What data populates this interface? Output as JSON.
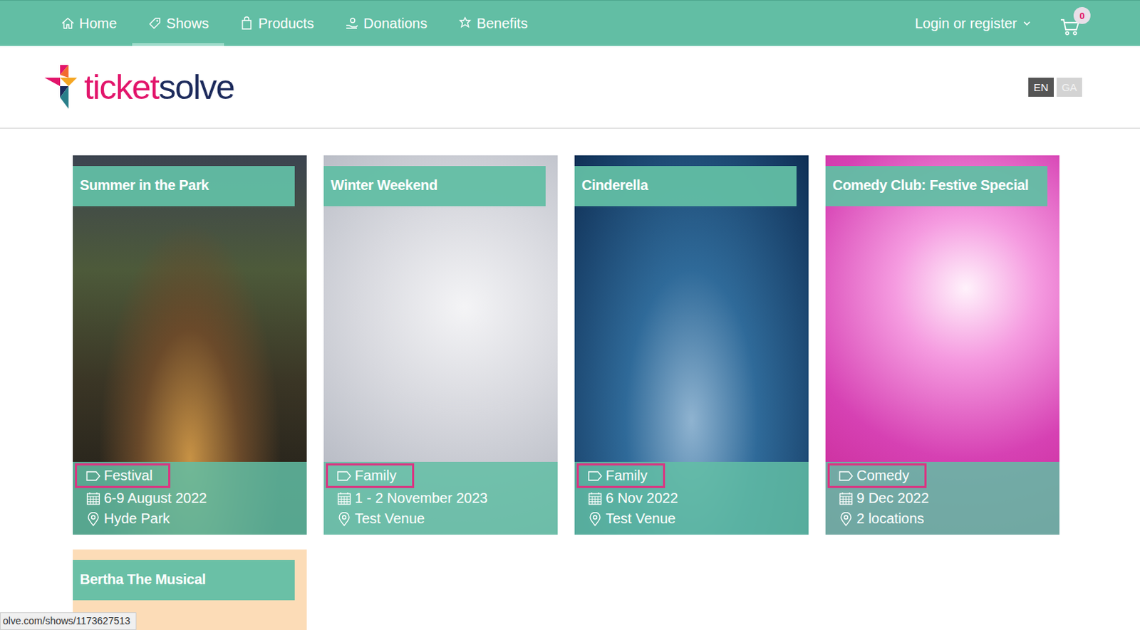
{
  "nav": {
    "items": [
      {
        "label": "Home",
        "selected": false
      },
      {
        "label": "Shows",
        "selected": true
      },
      {
        "label": "Products",
        "selected": false
      },
      {
        "label": "Donations",
        "selected": false
      },
      {
        "label": "Benefits",
        "selected": false
      }
    ],
    "login": "Login or register",
    "cart_count": "0"
  },
  "logo": {
    "parts": [
      "ticket",
      "solve"
    ]
  },
  "languages": [
    {
      "label": "EN",
      "selected": true
    },
    {
      "label": "GA",
      "selected": false
    }
  ],
  "shows": [
    {
      "title": "Summer in the Park",
      "tag": "Festival",
      "date": "6-9 August 2022",
      "venue": "Hyde Park",
      "highlighted": true
    },
    {
      "title": "Winter Weekend",
      "tag": "Family",
      "date": "1 - 2 November 2023",
      "venue": "Test Venue",
      "highlighted": true
    },
    {
      "title": "Cinderella",
      "tag": "Family",
      "date": "6 Nov 2022",
      "venue": "Test Venue",
      "highlighted": true
    },
    {
      "title": "Comedy Club: Festive Special",
      "tag": "Comedy",
      "date": "9 Dec 2022",
      "venue": "2 locations",
      "highlighted": true
    },
    {
      "title": "Bertha The Musical"
    }
  ],
  "status_bar": "olve.com/shows/1173627513"
}
